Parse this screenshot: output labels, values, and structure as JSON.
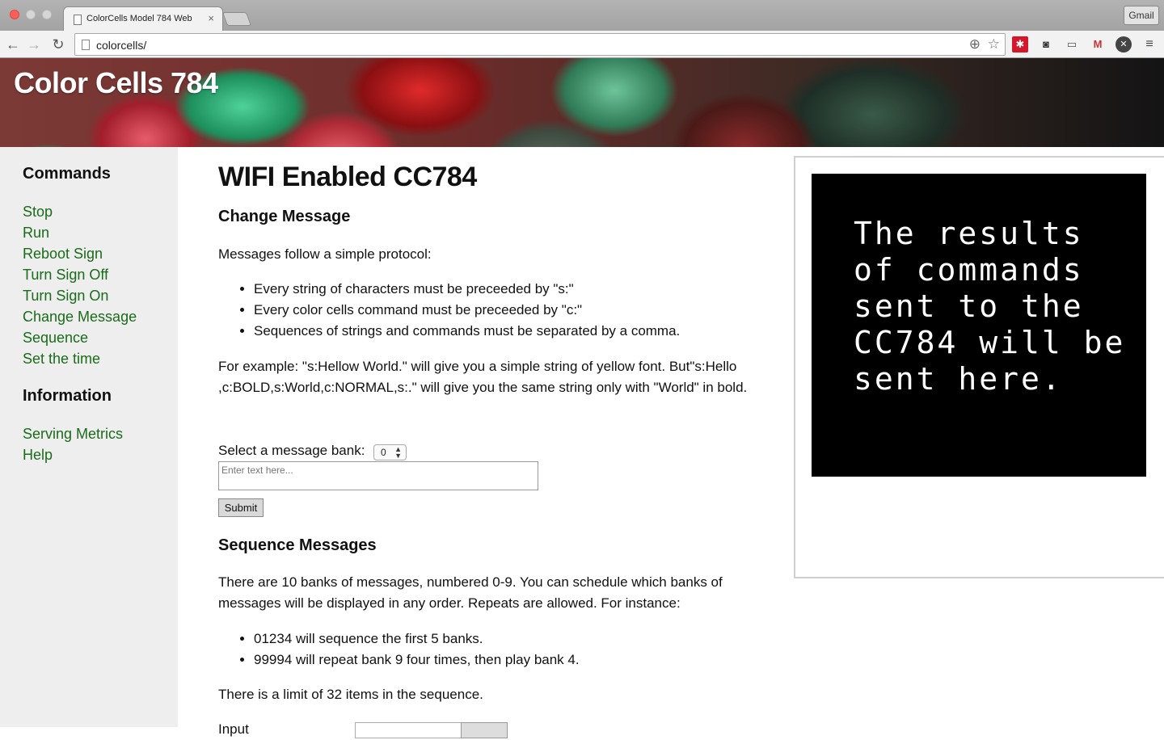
{
  "browser": {
    "tab_title": "ColorCells Model 784 Web",
    "tab_close": "×",
    "gmail_label": "Gmail",
    "url": "colorcells/",
    "icons": {
      "back": "←",
      "forward": "→",
      "reload": "↻",
      "zoom": "⊕",
      "star": "☆",
      "ext1": "✱",
      "ext2": "◙",
      "ext3": "▭",
      "ext4": "M",
      "ext5": "✕",
      "menu": "≡"
    }
  },
  "site": {
    "title": "Color Cells 784"
  },
  "sidebar": {
    "commands_heading": "Commands",
    "commands": [
      "Stop",
      "Run",
      "Reboot Sign",
      "Turn Sign Off",
      "Turn Sign On",
      "Change Message",
      "Sequence",
      "Set the time"
    ],
    "information_heading": "Information",
    "information": [
      "Serving Metrics",
      "Help"
    ]
  },
  "main": {
    "title": "WIFI Enabled CC784",
    "change_message": {
      "heading": "Change Message",
      "intro": "Messages follow a simple protocol:",
      "rules": [
        "Every string of characters must be preceeded by \"s:\"",
        "Every color cells command must be preceeded by \"c:\"",
        "Sequences of strings and commands must be separated by a comma."
      ],
      "example": "For example: \"s:Hellow World.\" will give you a simple string of yellow font. But\"s:Hello ,c:BOLD,s:World,c:NORMAL,s:.\" will give you the same string only with \"World\" in bold.",
      "bank_label": "Select a message bank:",
      "bank_value": "0",
      "text_placeholder": "Enter text here...",
      "submit_label": "Submit"
    },
    "sequence": {
      "heading": "Sequence Messages",
      "intro": "There are 10 banks of messages, numbered 0-9. You can schedule which banks of messages will be displayed in any order. Repeats are allowed. For instance:",
      "examples": [
        "01234 will sequence the first 5 banks.",
        "99994 will repeat bank 9 four times, then play bank 4."
      ],
      "limit": "There is a limit of 32 items in the sequence.",
      "input_label": "Input"
    }
  },
  "results": {
    "text": "The results of commands sent to the CC784 will be sent here."
  }
}
